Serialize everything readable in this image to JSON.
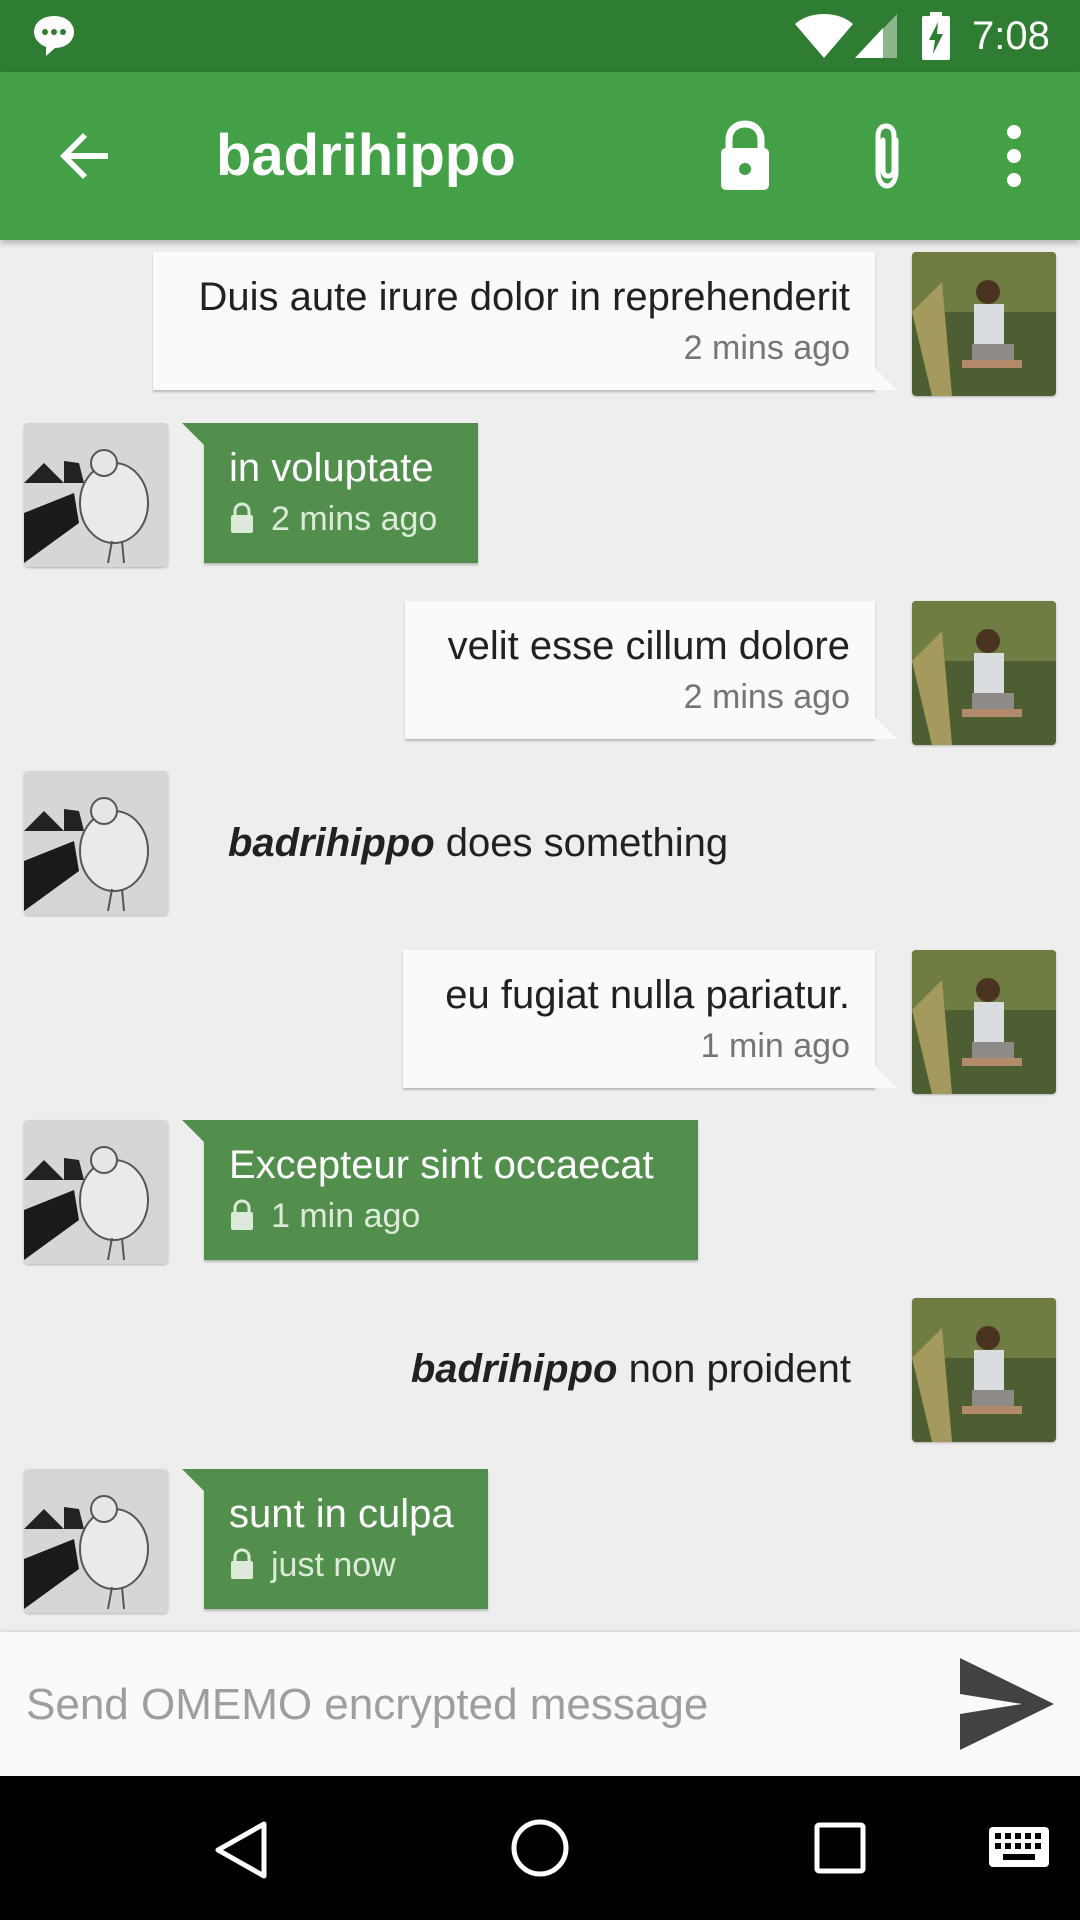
{
  "status_bar": {
    "time": "7:08"
  },
  "app_bar": {
    "title": "badrihippo"
  },
  "messages": [
    {
      "type": "sent",
      "text": "Duis aute irure dolor in reprehenderit",
      "time": "2 mins ago"
    },
    {
      "type": "received",
      "text": "in voluptate",
      "time": "2 mins ago",
      "encrypted": true
    },
    {
      "type": "sent",
      "text": "velit esse cillum dolore",
      "time": "2 mins ago"
    },
    {
      "type": "status",
      "side": "left",
      "nick": "badrihippo",
      "text": "does something"
    },
    {
      "type": "sent",
      "text": "eu fugiat nulla pariatur.",
      "time": "1 min ago"
    },
    {
      "type": "received",
      "text": "Excepteur sint occaecat",
      "time": "1 min ago",
      "encrypted": true
    },
    {
      "type": "status",
      "side": "right",
      "nick": "badrihippo",
      "text": "non proident"
    },
    {
      "type": "received",
      "text": "sunt in culpa",
      "time": "just now",
      "encrypted": true
    }
  ],
  "input": {
    "placeholder": "Send OMEMO encrypted message",
    "value": ""
  },
  "colors": {
    "primary": "#43a047",
    "primary_dark": "#2e7d32",
    "received_bubble": "#528f4d",
    "sent_bubble": "#fafafa",
    "background": "#eeeeee"
  },
  "icons": [
    "notification-chat-icon",
    "wifi-icon",
    "cell-signal-icon",
    "battery-charging-icon",
    "back-arrow-icon",
    "lock-icon",
    "attach-icon",
    "more-vert-icon",
    "send-icon",
    "nav-back-icon",
    "nav-home-icon",
    "nav-recents-icon",
    "keyboard-icon"
  ]
}
